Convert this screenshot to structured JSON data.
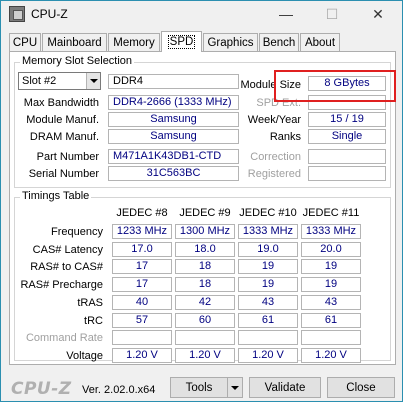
{
  "window": {
    "title": "CPU-Z",
    "minimize": "—",
    "maximize": "☐",
    "close": "✕"
  },
  "tabs": [
    "CPU",
    "Mainboard",
    "Memory",
    "SPD",
    "Graphics",
    "Bench",
    "About"
  ],
  "active_tab": "SPD",
  "memory_slot": {
    "group_title": "Memory Slot Selection",
    "slot_selected": "Slot #2",
    "module_type": "DDR4",
    "labels": {
      "max_bandwidth": "Max Bandwidth",
      "module_manuf": "Module Manuf.",
      "dram_manuf": "DRAM Manuf.",
      "part_number": "Part Number",
      "serial_number": "Serial Number",
      "module_size": "Module Size",
      "spd_ext": "SPD Ext.",
      "week_year": "Week/Year",
      "ranks": "Ranks",
      "correction": "Correction",
      "registered": "Registered"
    },
    "values": {
      "max_bandwidth": "DDR4-2666 (1333 MHz)",
      "module_manuf": "Samsung",
      "dram_manuf": "Samsung",
      "part_number": "M471A1K43DB1-CTD",
      "serial_number": "31C563BC",
      "module_size": "8 GBytes",
      "spd_ext": "",
      "week_year": "15 / 19",
      "ranks": "Single",
      "correction": "",
      "registered": ""
    }
  },
  "timings": {
    "group_title": "Timings Table",
    "columns": [
      "JEDEC #8",
      "JEDEC #9",
      "JEDEC #10",
      "JEDEC #11"
    ],
    "rows": [
      {
        "label": "Frequency",
        "values": [
          "1233 MHz",
          "1300 MHz",
          "1333 MHz",
          "1333 MHz"
        ],
        "disabled": false
      },
      {
        "label": "CAS# Latency",
        "values": [
          "17.0",
          "18.0",
          "19.0",
          "20.0"
        ],
        "disabled": false
      },
      {
        "label": "RAS# to CAS#",
        "values": [
          "17",
          "18",
          "19",
          "19"
        ],
        "disabled": false
      },
      {
        "label": "RAS# Precharge",
        "values": [
          "17",
          "18",
          "19",
          "19"
        ],
        "disabled": false
      },
      {
        "label": "tRAS",
        "values": [
          "40",
          "42",
          "43",
          "43"
        ],
        "disabled": false
      },
      {
        "label": "tRC",
        "values": [
          "57",
          "60",
          "61",
          "61"
        ],
        "disabled": false
      },
      {
        "label": "Command Rate",
        "values": [
          "",
          "",
          "",
          ""
        ],
        "disabled": true
      },
      {
        "label": "Voltage",
        "values": [
          "1.20 V",
          "1.20 V",
          "1.20 V",
          "1.20 V"
        ],
        "disabled": false
      }
    ]
  },
  "footer": {
    "logo": "CPU-Z",
    "version": "Ver. 2.02.0.x64",
    "tools_label": "Tools",
    "validate_label": "Validate",
    "close_label": "Close"
  },
  "colors": {
    "value_text": "#000080",
    "highlight_box": "#e02020"
  }
}
